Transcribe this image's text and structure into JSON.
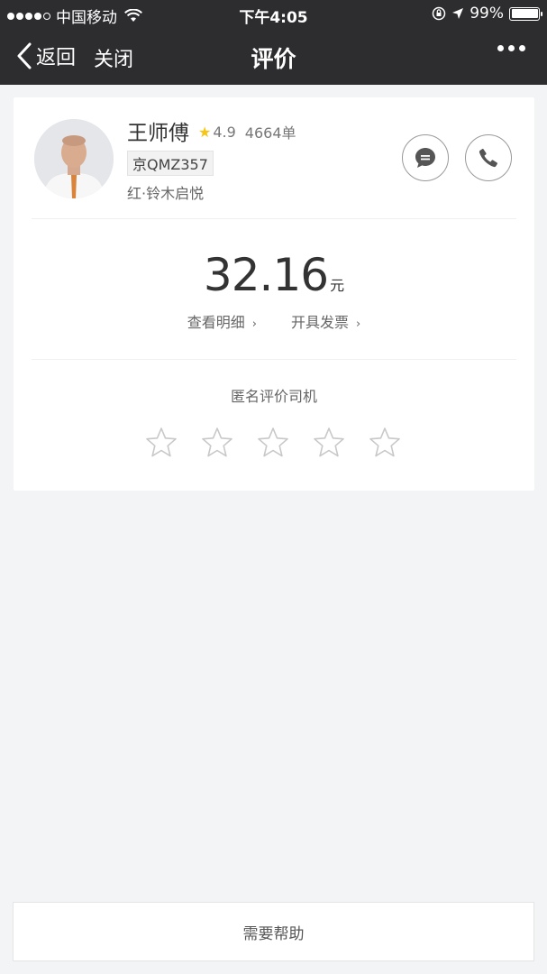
{
  "status_bar": {
    "carrier": "中国移动",
    "time": "下午4:05",
    "battery": "99%"
  },
  "nav": {
    "back_label": "返回",
    "close_label": "关闭",
    "title": "评价"
  },
  "driver": {
    "name": "王师傅",
    "rating": "4.9",
    "orders": "4664单",
    "plate": "京QMZ357",
    "car": "红·铃木启悦"
  },
  "fare": {
    "amount": "32.16",
    "unit": "元",
    "details_link": "查看明细",
    "invoice_link": "开具发票"
  },
  "review": {
    "prompt": "匿名评价司机",
    "stars_selected": 0,
    "stars_total": 5
  },
  "footer": {
    "help_label": "需要帮助"
  },
  "colors": {
    "nav_bg": "#2d2d30",
    "page_bg": "#f3f4f6",
    "rating_star": "#f5c518"
  },
  "icons": [
    "back-chevron-icon",
    "wifi-icon",
    "lock-rotation-icon",
    "location-arrow-icon",
    "battery-icon",
    "more-icon",
    "message-icon",
    "phone-icon",
    "star-icon"
  ]
}
